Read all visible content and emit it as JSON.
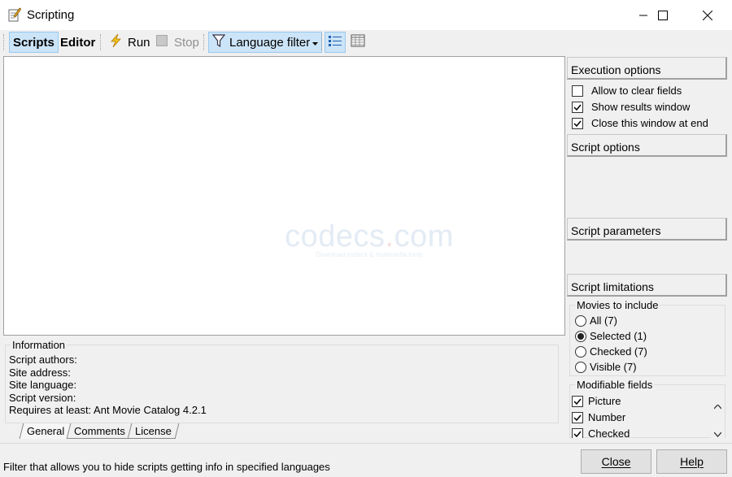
{
  "window": {
    "title": "Scripting"
  },
  "toolbar": {
    "scripts_label": "Scripts",
    "editor_label": "Editor",
    "run_label": "Run",
    "stop_label": "Stop",
    "language_filter_label": "Language filter"
  },
  "info": {
    "title": "Information",
    "lines": [
      "Script authors:",
      "Site address:",
      "Site language:",
      "Script version:",
      "Requires at least: Ant Movie Catalog 4.2.1"
    ]
  },
  "tabs": [
    "General",
    "Comments",
    "License"
  ],
  "watermark": {
    "main": "codecs",
    "dot": ".",
    "tld": "com",
    "sub": "Download codecs & multimedia tools"
  },
  "side": {
    "execution_options": {
      "title": "Execution options",
      "items": [
        {
          "label": "Allow to clear fields",
          "checked": false
        },
        {
          "label": "Show results window",
          "checked": true
        },
        {
          "label": "Close this window at end",
          "checked": true
        }
      ]
    },
    "script_options_title": "Script options",
    "script_parameters_title": "Script parameters",
    "script_limitations_title": "Script limitations",
    "movies_to_include": {
      "title": "Movies to include",
      "options": [
        {
          "label": "All (7)",
          "selected": false
        },
        {
          "label": "Selected (1)",
          "selected": true
        },
        {
          "label": "Checked (7)",
          "selected": false
        },
        {
          "label": "Visible (7)",
          "selected": false
        }
      ]
    },
    "modifiable_fields": {
      "title": "Modifiable fields",
      "items": [
        {
          "label": "Picture",
          "checked": true
        },
        {
          "label": "Number",
          "checked": true
        },
        {
          "label": "Checked",
          "checked": true
        }
      ]
    }
  },
  "status_text": "Filter that allows you to hide scripts getting info in specified languages",
  "buttons": {
    "close_label": "Close",
    "help_label": "Help"
  },
  "colors": {
    "pressed_bg": "#cce4f7",
    "pressed_border": "#99c9ef",
    "window_bg": "#f0f0f0"
  }
}
